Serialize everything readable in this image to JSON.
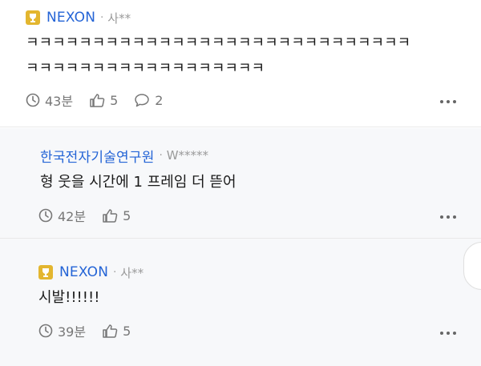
{
  "comments": [
    {
      "company": "NEXON",
      "nickname": "사**",
      "text": "ㅋㅋㅋㅋㅋㅋㅋㅋㅋㅋㅋㅋㅋㅋㅋㅋㅋㅋㅋㅋㅋㅋㅋㅋㅋㅋㅋㅋㅋ\nㅋㅋㅋㅋㅋㅋㅋㅋㅋㅋㅋㅋㅋㅋㅋㅋㅋㅋ",
      "time": "43분",
      "likes": "5",
      "replies": "2"
    },
    {
      "company": "한국전자기술연구원",
      "nickname": "W*****",
      "text": "형 웃을 시간에 1 프레임 더 뜯어",
      "time": "42분",
      "likes": "5"
    },
    {
      "company": "NEXON",
      "nickname": "사**",
      "text": "시발!!!!!!",
      "time": "39분",
      "likes": "5"
    }
  ],
  "icons": {
    "badge": "trophy-badge-icon",
    "time": "clock-icon",
    "like": "thumbs-up-icon",
    "reply": "speech-bubble-icon",
    "more": "more-dots-icon"
  },
  "colors": {
    "company": "#2464d6",
    "badge": "#e3b62f",
    "meta_gray": "#9a9a9a",
    "reply_bg": "#f7f8fa"
  }
}
